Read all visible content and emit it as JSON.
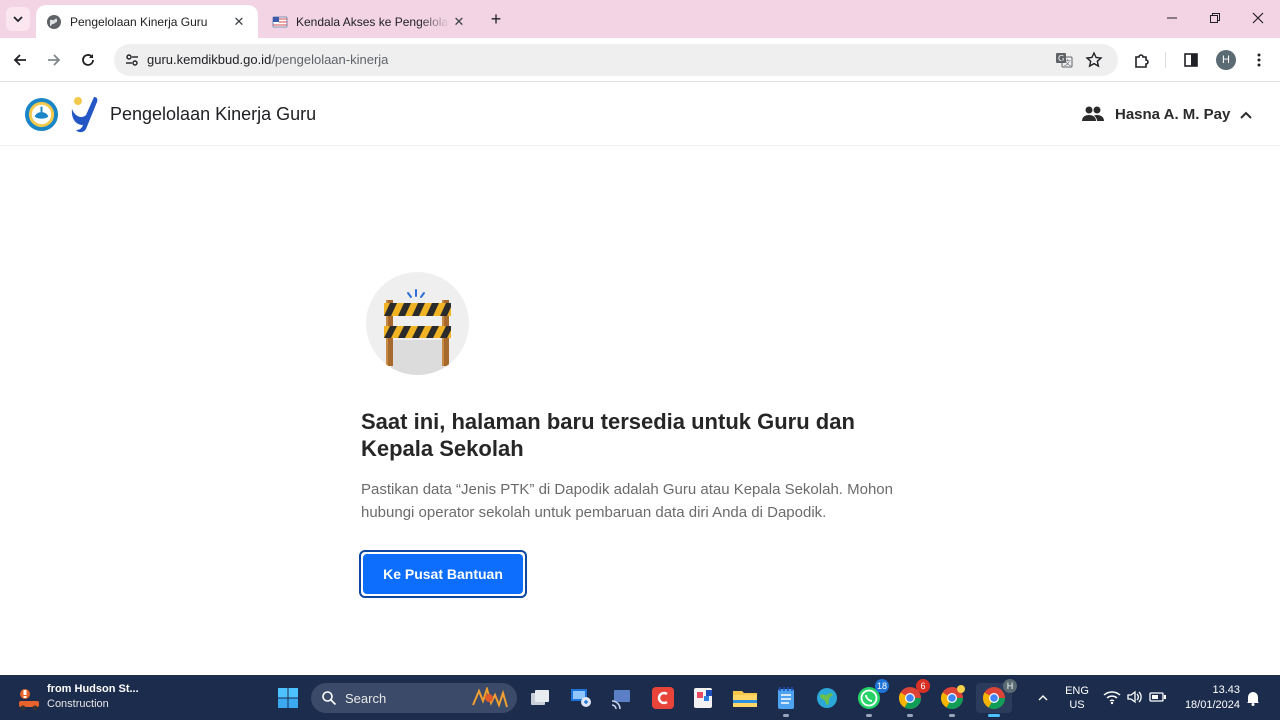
{
  "browser": {
    "tabs": [
      {
        "title": "Pengelolaan Kinerja Guru",
        "active": true
      },
      {
        "title": "Kendala Akses ke Pengelolaan Kinerja",
        "active": false
      }
    ],
    "url_domain": "guru.kemdikbud.go.id",
    "url_path": "/pengelolaan-kinerja",
    "profile_initial": "H"
  },
  "app": {
    "title": "Pengelolaan Kinerja Guru",
    "user_name": "Hasna A. M. Pay"
  },
  "main": {
    "headline": "Saat ini, halaman baru tersedia untuk Guru dan Kepala Sekolah",
    "description": "Pastikan data “Jenis PTK” di Dapodik adalah Guru atau Kepala Sekolah. Mohon hubungi operator sekolah untuk pembaruan data diri Anda di Dapodik.",
    "cta_label": "Ke Pusat Bantuan"
  },
  "taskbar": {
    "weather_title": "from Hudson St...",
    "weather_sub": "Construction",
    "search_placeholder": "Search",
    "whatsapp_badge": "18",
    "chrome_badge": "6",
    "profile_badge": "H",
    "language_line1": "ENG",
    "language_line2": "US",
    "time": "13.43",
    "date": "18/01/2024"
  },
  "colors": {
    "tabstrip": "#f3d4e4",
    "accent_button": "#0d6efd",
    "taskbar": "#1c2c4c"
  }
}
